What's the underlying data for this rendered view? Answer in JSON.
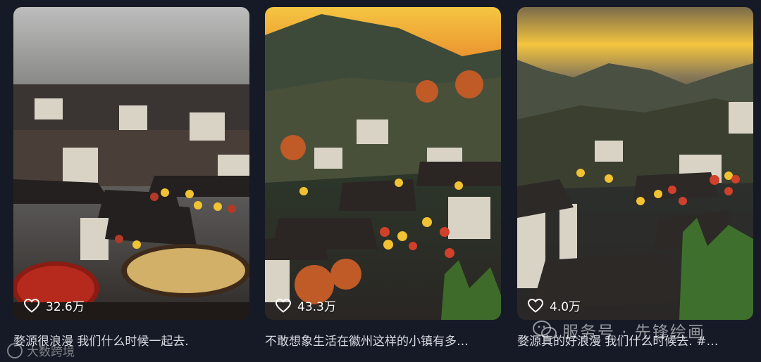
{
  "cards": [
    {
      "likes": "32.6万",
      "caption": "婺源很浪漫 我们什么时候一起去."
    },
    {
      "likes": "43.3万",
      "caption": "不敢想象生活在徽州这样的小镇有多…"
    },
    {
      "likes": "4.0万",
      "caption": "婺源真的好浪漫 我们什么时候去. #…"
    }
  ],
  "watermarks": {
    "left": "大数跨境",
    "right": "服务号 · 先锋绘画"
  },
  "colors": {
    "background": "#161a26",
    "caption_text": "#d9dbe2",
    "sunset_orange": "#f0a020"
  },
  "icons": [
    "heart-icon",
    "wechat-icon"
  ]
}
